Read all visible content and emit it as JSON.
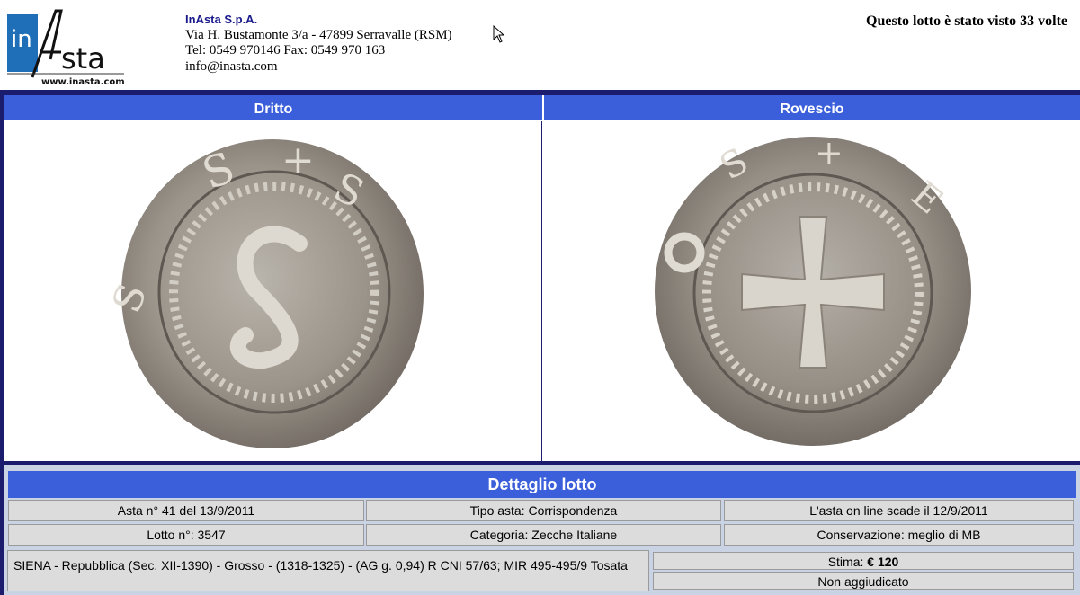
{
  "header": {
    "logo_text": "inAsta",
    "logo_url": "www.inasta.com",
    "company_name": "InAsta S.p.A.",
    "address": "Via H. Bustamonte 3/a - 47899 Serravalle (RSM)",
    "phone": "Tel: 0549 970146 Fax: 0549 970 163",
    "email": "info@inasta.com",
    "views_text": "Questo lotto è stato visto 33 volte"
  },
  "images": {
    "obverse_label": "Dritto",
    "reverse_label": "Rovescio"
  },
  "detail": {
    "title": "Dettaglio lotto",
    "asta": "Asta n° 41 del 13/9/2011",
    "tipo_asta": "Tipo asta: Corrispondenza",
    "scadenza": "L'asta on line scade il 12/9/2011",
    "lotto": "Lotto n°: 3547",
    "categoria": "Categoria: Zecche Italiane",
    "conservazione": "Conservazione: meglio di MB",
    "description": "SIENA - Repubblica (Sec. XII-1390) - Grosso - (1318-1325) - (AG g. 0,94) R CNI 57/63; MIR 495-495/9 Tosata",
    "stima_label": "Stima:",
    "stima_value": "€ 120",
    "status": "Non aggiudicato"
  },
  "colors": {
    "header_bar": "#3b5fdb",
    "frame": "#1c1c6e",
    "cell_bg": "#dcdcdc",
    "panel_bg": "#c9d3e4"
  }
}
